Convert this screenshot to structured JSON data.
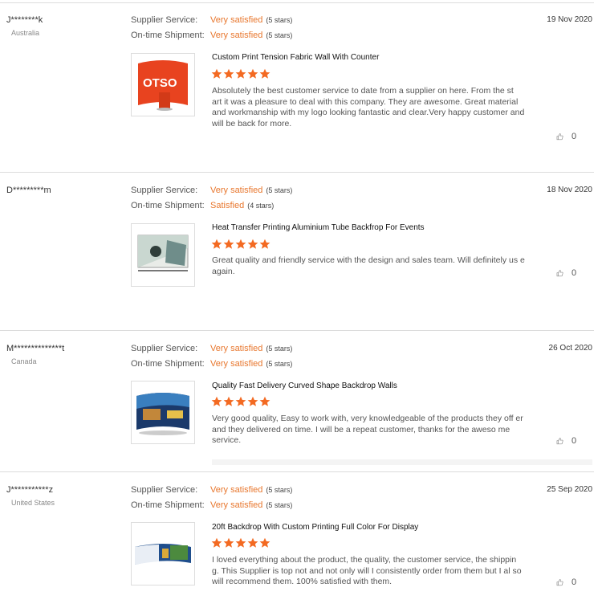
{
  "labels": {
    "supplier_service": "Supplier Service:",
    "ontime_shipment": "On-time Shipment:"
  },
  "colors": {
    "accent": "#e8772e",
    "star": "#f36a22"
  },
  "reviews": [
    {
      "user": "J********k",
      "country": "Australia",
      "date": "19 Nov 2020",
      "supplier_rating": "Very satisfied",
      "supplier_stars": "(5 stars)",
      "shipment_rating": "Very satisfied",
      "shipment_stars": "(5 stars)",
      "product": "Custom Print Tension Fabric Wall With Counter",
      "stars": 5,
      "comment": "Absolutely the best customer service to date from a supplier on here. From the st art it was a pleasure to deal with this company. They are awesome. Great material and workmanship with my logo looking fantastic and clear.Very happy customer and will be back for more.",
      "likes": "0"
    },
    {
      "user": "D*********m",
      "country": "",
      "date": "18 Nov 2020",
      "supplier_rating": "Very satisfied",
      "supplier_stars": "(5 stars)",
      "shipment_rating": "Satisfied",
      "shipment_stars": "(4 stars)",
      "product": "Heat Transfer Printing Aluminium Tube Backfrop For Events",
      "stars": 5,
      "comment": "Great quality and friendly service with the design and sales team. Will definitely us e again.",
      "likes": "0"
    },
    {
      "user": "M**************t",
      "country": "Canada",
      "date": "26 Oct 2020",
      "supplier_rating": "Very satisfied",
      "supplier_stars": "(5 stars)",
      "shipment_rating": "Very satisfied",
      "shipment_stars": "(5 stars)",
      "product": "Quality Fast Delivery Curved Shape Backdrop Walls",
      "stars": 5,
      "comment": "Very good quality, Easy to work with, very knowledgeable of the products they off er and they delivered on time.   I will be a repeat customer,  thanks for the aweso me service.",
      "likes": "0"
    },
    {
      "user": "J***********z",
      "country": "United States",
      "date": "25 Sep 2020",
      "supplier_rating": "Very satisfied",
      "supplier_stars": "(5 stars)",
      "shipment_rating": "Very satisfied",
      "shipment_stars": "(5 stars)",
      "product": "20ft Backdrop With Custom Printing Full Color For Display",
      "stars": 5,
      "comment": "I loved everything about the product, the quality, the customer service, the shippin g.  This Supplier is top not and not only will I consistently order from them but I al so will recommend them. 100% satisfied with them.",
      "likes": "0"
    }
  ],
  "thumb_text": {
    "otso": "OTSO"
  }
}
